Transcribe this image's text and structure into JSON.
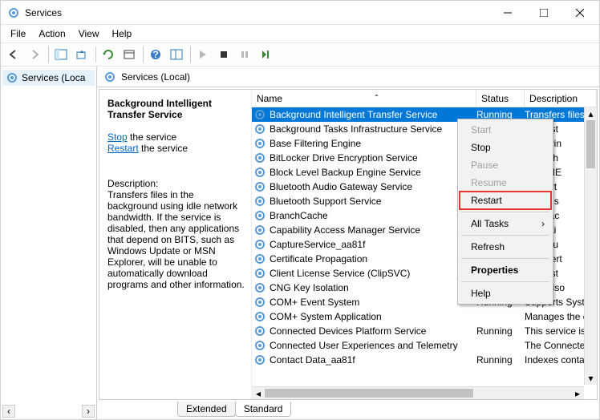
{
  "window": {
    "title": "Services"
  },
  "menu": {
    "file": "File",
    "action": "Action",
    "view": "View",
    "help": "Help"
  },
  "tree": {
    "root": "Services (Local)",
    "root_truncated": "Services (Loca"
  },
  "local_header": "Services (Local)",
  "detail": {
    "title": "Background Intelligent Transfer Service",
    "stop": "Stop",
    "stop_after": " the service",
    "restart": "Restart",
    "restart_after": " the service",
    "desc_label": "Description:",
    "desc_text": "Transfers files in the background using idle network bandwidth. If the service is disabled, then any applications that depend on BITS, such as Windows Update or MSN Explorer, will be unable to automatically download programs and other information."
  },
  "columns": {
    "name": "Name",
    "status": "Status",
    "description": "Description",
    "sort_indicator": "ˆ"
  },
  "services": [
    {
      "name": "Background Intelligent Transfer Service",
      "status": "Running",
      "desc": "Transfers files in",
      "selected": true
    },
    {
      "name": "Background Tasks Infrastructure Service",
      "status": "",
      "desc": "s infrast"
    },
    {
      "name": "Base Filtering Engine",
      "status": "",
      "desc": "e Filterin"
    },
    {
      "name": "BitLocker Drive Encryption Service",
      "status": "",
      "desc": "hosts th"
    },
    {
      "name": "Block Level Backup Engine Service",
      "status": "",
      "desc": "ENGINE"
    },
    {
      "name": "Bluetooth Audio Gateway Service",
      "status": "",
      "desc": "support"
    },
    {
      "name": "Bluetooth Support Service",
      "status": "",
      "desc": "etooth s"
    },
    {
      "name": "BranchCache",
      "status": "",
      "desc": "vice cac"
    },
    {
      "name": "Capability Access Manager Service",
      "status": "",
      "desc": "s faciliti"
    },
    {
      "name": "CaptureService_aa81f",
      "status": "",
      "desc": "e Captu"
    },
    {
      "name": "Certificate Propagation",
      "status": "",
      "desc": "user cert"
    },
    {
      "name": "Client License Service (ClipSVC)",
      "status": "",
      "desc": "s infrast"
    },
    {
      "name": "CNG Key Isolation",
      "status": "",
      "desc": "G key iso"
    },
    {
      "name": "COM+ Event System",
      "status": "Running",
      "desc": "Supports Syster"
    },
    {
      "name": "COM+ System Application",
      "status": "",
      "desc": "Manages the co"
    },
    {
      "name": "Connected Devices Platform Service",
      "status": "Running",
      "desc": "This service is u"
    },
    {
      "name": "Connected User Experiences and Telemetry",
      "status": "",
      "desc": "The Connected"
    },
    {
      "name": "Contact Data_aa81f",
      "status": "Running",
      "desc": "Indexes contact"
    }
  ],
  "ctx": {
    "start": "Start",
    "stop": "Stop",
    "pause": "Pause",
    "resume": "Resume",
    "restart": "Restart",
    "alltasks": "All Tasks",
    "refresh": "Refresh",
    "properties": "Properties",
    "help": "Help"
  },
  "tabs": {
    "extended": "Extended",
    "standard": "Standard"
  }
}
